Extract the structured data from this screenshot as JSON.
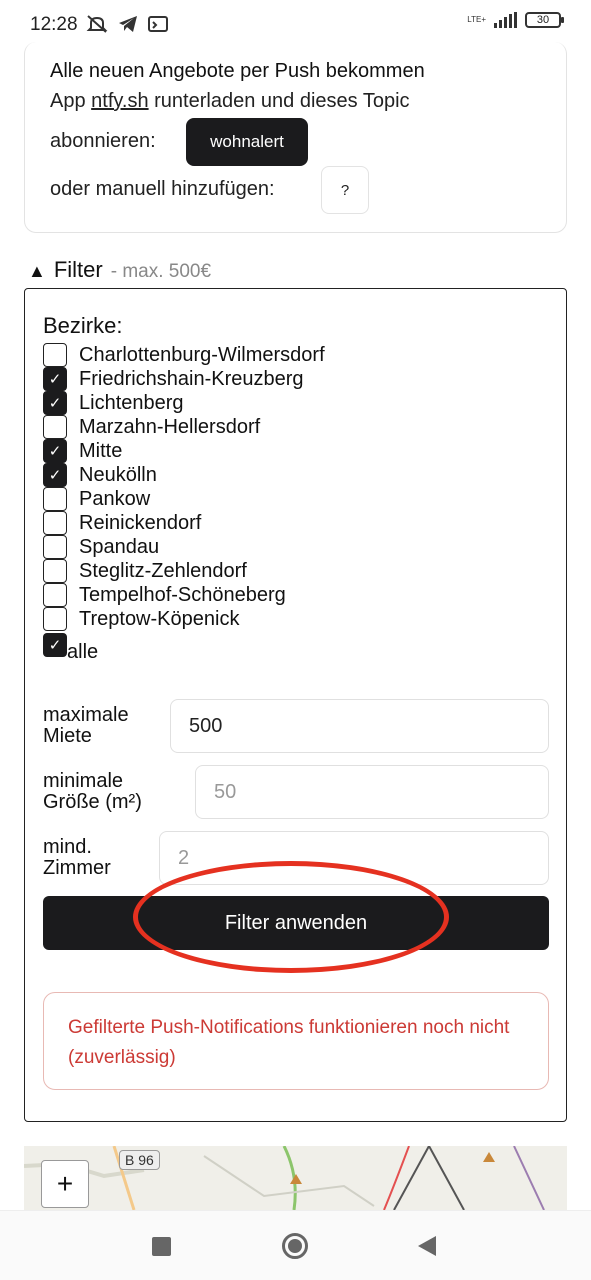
{
  "status": {
    "time": "12:28",
    "network": "LTE+",
    "battery": "30"
  },
  "push": {
    "title": "Alle neuen Angebote per Push bekommen",
    "line2_prefix": "App ",
    "line2_link": "ntfy.sh",
    "line2_suffix": " runterladen und dieses Topic",
    "line3": "abonnieren:",
    "topic_button": "wohnalert",
    "line4": "oder manuell hinzufügen:",
    "help_button": "?"
  },
  "filter": {
    "triangle": "▲",
    "label": "Filter",
    "hint": "- max. 500€",
    "bezirke_label": "Bezirke:",
    "districts": [
      {
        "name": "Charlottenburg-Wilmersdorf",
        "checked": false
      },
      {
        "name": "Friedrichshain-Kreuzberg",
        "checked": true
      },
      {
        "name": "Lichtenberg",
        "checked": true
      },
      {
        "name": "Marzahn-Hellersdorf",
        "checked": false
      },
      {
        "name": "Mitte",
        "checked": true
      },
      {
        "name": "Neukölln",
        "checked": true
      },
      {
        "name": "Pankow",
        "checked": false
      },
      {
        "name": "Reinickendorf",
        "checked": false
      },
      {
        "name": "Spandau",
        "checked": false
      },
      {
        "name": "Steglitz-Zehlendorf",
        "checked": false
      },
      {
        "name": "Tempelhof-Schöneberg",
        "checked": false
      },
      {
        "name": "Treptow-Köpenick",
        "checked": false
      }
    ],
    "alle_label": "alle",
    "alle_checked": true,
    "max_rent_label_1": "maximale",
    "max_rent_label_2": "Miete",
    "max_rent_value": "500",
    "min_size_label_1": "minimale",
    "min_size_label_2": "Größe (m²)",
    "min_size_placeholder": "50",
    "min_rooms_label_1": "mind.",
    "min_rooms_label_2": "Zimmer",
    "min_rooms_placeholder": "2",
    "apply_button": "Filter anwenden",
    "warning": "Gefilterte Push-Notifications funktionieren noch nicht (zuverlässig)"
  },
  "map": {
    "zoom_in": "+",
    "road_label": "B 96"
  }
}
